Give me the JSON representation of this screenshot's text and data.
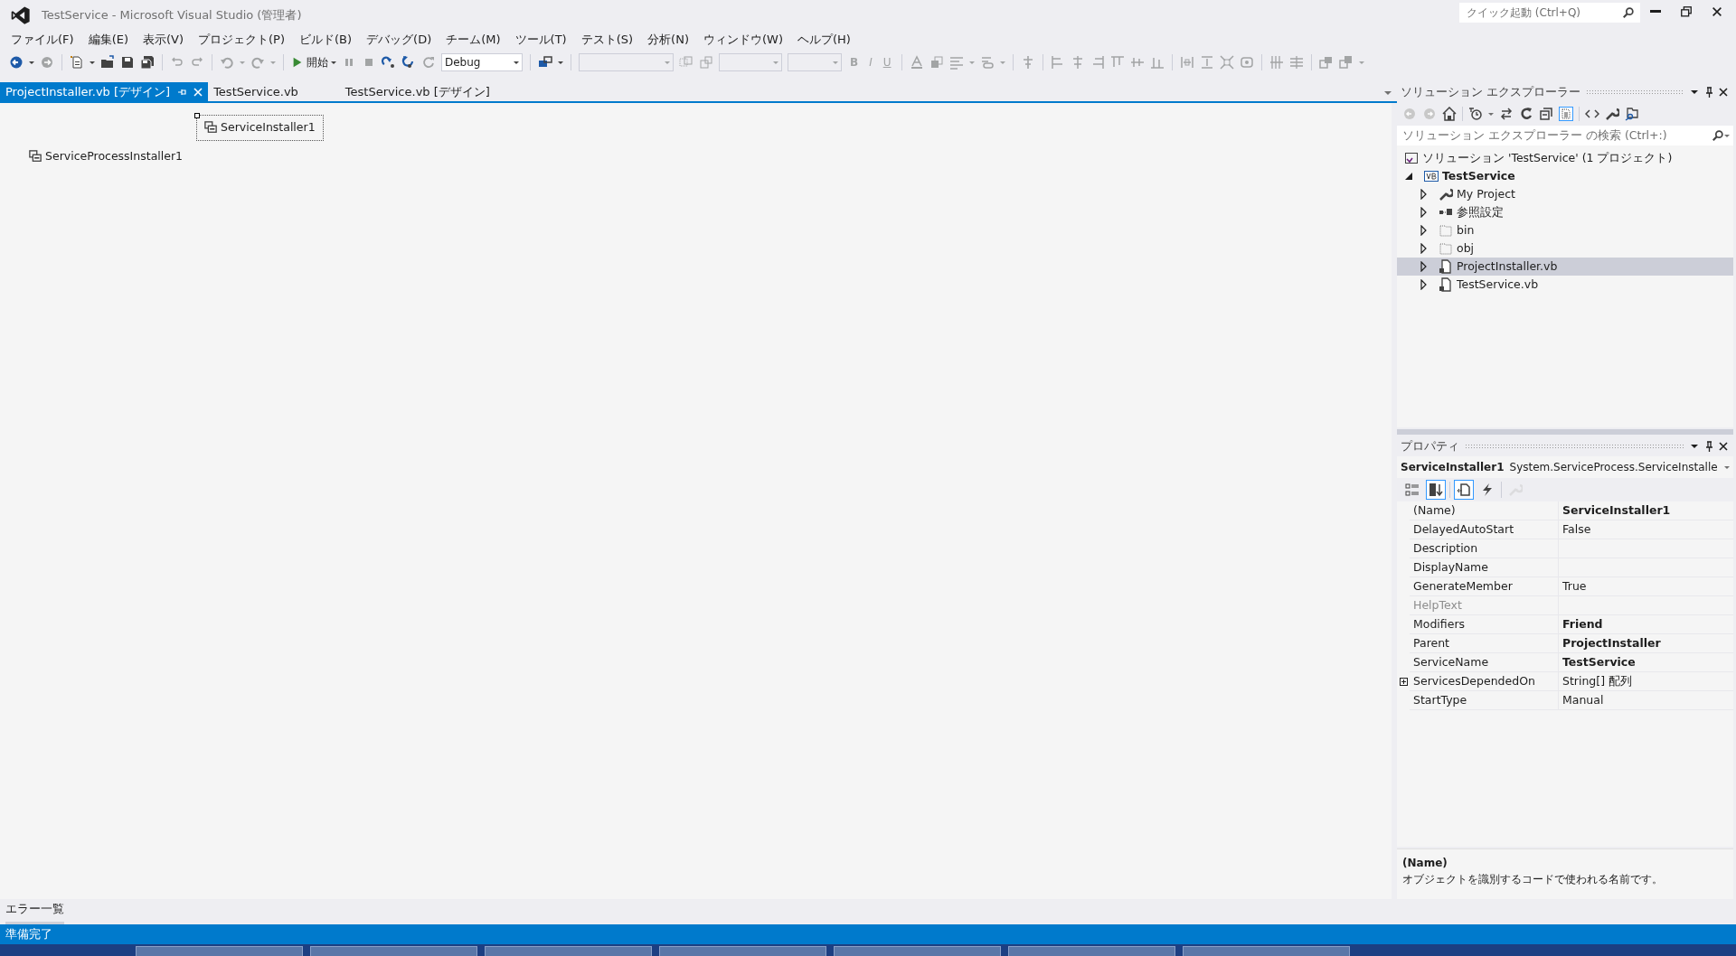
{
  "window": {
    "title": "TestService - Microsoft Visual Studio (管理者)",
    "quick_launch": {
      "placeholder": "クイック起動 (Ctrl+Q)"
    }
  },
  "menu": [
    "ファイル(F)",
    "編集(E)",
    "表示(V)",
    "プロジェクト(P)",
    "ビルド(B)",
    "デバッグ(D)",
    "チーム(M)",
    "ツール(T)",
    "テスト(S)",
    "分析(N)",
    "ウィンドウ(W)",
    "ヘルプ(H)"
  ],
  "toolbar": {
    "start_label": "開始",
    "configuration": "Debug",
    "format_buttons": [
      "B",
      "I",
      "U"
    ]
  },
  "editor_tabs": [
    {
      "label": "ProjectInstaller.vb [デザイン]",
      "selected": true
    },
    {
      "label": "TestService.vb",
      "selected": false
    },
    {
      "label": "TestService.vb [デザイン]",
      "selected": false
    }
  ],
  "designer": {
    "components": [
      {
        "label": "ServiceInstaller1",
        "selected": true
      },
      {
        "label": "ServiceProcessInstaller1",
        "selected": false
      }
    ]
  },
  "solution_explorer": {
    "title": "ソリューション エクスプローラー",
    "search": {
      "placeholder": "ソリューション エクスプローラー の検索 (Ctrl+:)"
    },
    "tree": [
      {
        "label": "ソリューション 'TestService' (1 プロジェクト)",
        "kind": "solution",
        "selected": false,
        "children": [
          {
            "label": "TestService",
            "kind": "project",
            "expanded": true,
            "selected": false,
            "children": [
              {
                "label": "My Project",
                "kind": "settings",
                "expanded": false,
                "selected": false
              },
              {
                "label": "参照設定",
                "kind": "references",
                "expanded": false,
                "selected": false
              },
              {
                "label": "bin",
                "kind": "folder",
                "expanded": false,
                "selected": false
              },
              {
                "label": "obj",
                "kind": "folder",
                "expanded": false,
                "selected": false
              },
              {
                "label": "ProjectInstaller.vb",
                "kind": "file",
                "expanded": false,
                "selected": true
              },
              {
                "label": "TestService.vb",
                "kind": "file",
                "expanded": false,
                "selected": false
              }
            ]
          }
        ]
      }
    ]
  },
  "properties": {
    "title": "プロパティ",
    "object_name": "ServiceInstaller1",
    "object_type": "System.ServiceProcess.ServiceInstalle",
    "toolbar": [
      {
        "kind": "categorized",
        "selected": false,
        "disabled": false
      },
      {
        "kind": "alphabetical",
        "selected": true,
        "disabled": false
      },
      {
        "kind": "properties",
        "selected": true,
        "disabled": false
      },
      {
        "kind": "events",
        "selected": false,
        "disabled": false
      },
      {
        "kind": "pages",
        "selected": false,
        "disabled": true
      }
    ],
    "rows": [
      {
        "name": "(Name)",
        "value": "ServiceInstaller1",
        "bold": true,
        "disabled": false
      },
      {
        "name": "DelayedAutoStart",
        "value": "False",
        "disabled": false
      },
      {
        "name": "Description",
        "disabled": false
      },
      {
        "name": "DisplayName",
        "disabled": false
      },
      {
        "name": "GenerateMember",
        "value": "True",
        "disabled": false
      },
      {
        "name": "HelpText",
        "disabled": true
      },
      {
        "name": "Modifiers",
        "value": "Friend",
        "bold": true,
        "disabled": false
      },
      {
        "name": "Parent",
        "value": "ProjectInstaller",
        "bold": true,
        "disabled": false
      },
      {
        "name": "ServiceName",
        "value": "TestService",
        "bold": true,
        "disabled": false
      },
      {
        "name": "ServicesDependedOn",
        "value": "String[] 配列",
        "disabled": false,
        "expanded": false
      },
      {
        "name": "StartType",
        "value": "Manual",
        "disabled": false
      }
    ],
    "description": {
      "title": "(Name)",
      "text": "オブジェクトを識別するコードで使われる名前です。"
    }
  },
  "bottom_tabs": [
    {
      "label": "エラー一覧",
      "selected": false
    }
  ],
  "status_bar": {
    "text": "準備完了"
  }
}
